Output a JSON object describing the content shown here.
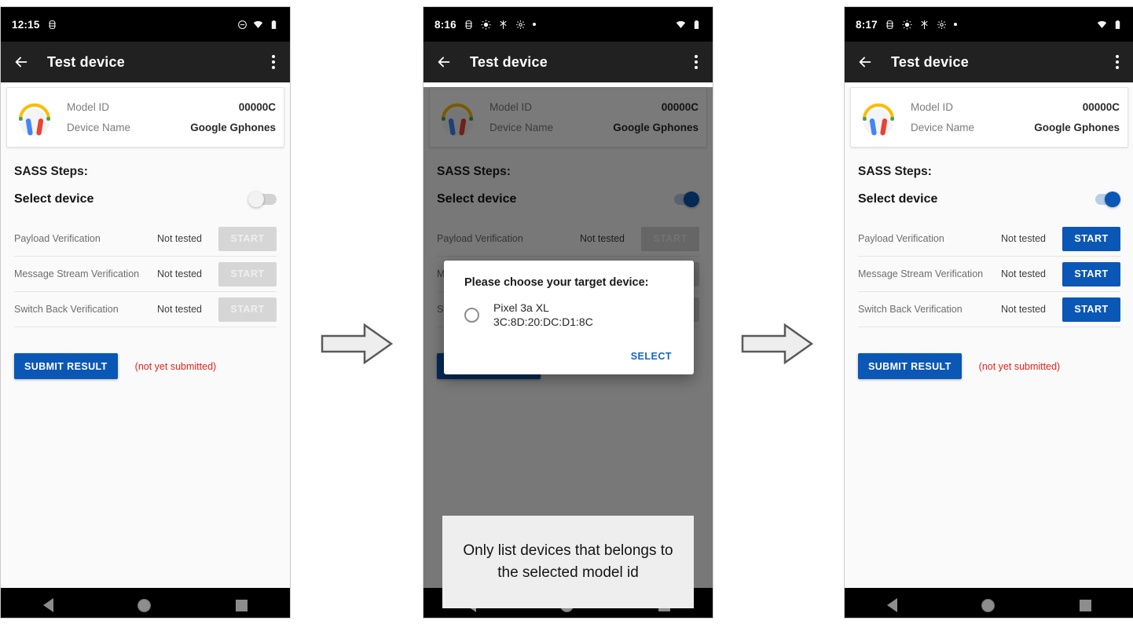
{
  "colors": {
    "accent_blue": "#0b57b5",
    "link_blue": "#1565c0",
    "error_red": "#e8231f",
    "appbar_dark": "#212121",
    "disabled_gray": "#d6d6d6"
  },
  "device": {
    "icon": "headphones-icon",
    "rows": [
      {
        "label": "Model ID",
        "value": "00000C"
      },
      {
        "label": "Device Name",
        "value": "Google Gphones"
      }
    ]
  },
  "appbar": {
    "back_icon": "back-arrow-icon",
    "title": "Test device",
    "overflow_icon": "overflow-menu-icon"
  },
  "navbar": {
    "back": "nav-back-icon",
    "home": "nav-home-icon",
    "recent": "nav-recent-icon"
  },
  "sass": {
    "heading": "SASS Steps:",
    "select_device_label": "Select device",
    "steps": [
      {
        "name": "Payload Verification",
        "status": "Not tested",
        "action": "START"
      },
      {
        "name": "Message Stream Verification",
        "status": "Not tested",
        "action": "START"
      },
      {
        "name": "Switch Back Verification",
        "status": "Not tested",
        "action": "START"
      }
    ],
    "submit_label": "SUBMIT RESULT",
    "submit_note": "(not yet submitted)"
  },
  "screens": [
    {
      "id": "screen-1",
      "status_bar": {
        "time": "12:15",
        "left_icons": [
          "android-debug-icon"
        ],
        "right_icons": [
          "do-not-disturb-icon",
          "wifi-icon",
          "battery-icon"
        ]
      },
      "toggle_state": "off"
    },
    {
      "id": "screen-2",
      "status_bar": {
        "time": "8:16",
        "left_icons": [
          "android-debug-icon",
          "brightness-icon",
          "bluetooth-search-icon",
          "settings-gear-icon",
          "dot-icon"
        ],
        "right_icons": [
          "wifi-icon",
          "battery-icon"
        ]
      },
      "toggle_state": "on"
    },
    {
      "id": "screen-3",
      "status_bar": {
        "time": "8:17",
        "left_icons": [
          "android-debug-icon",
          "brightness-icon",
          "bluetooth-search-icon",
          "settings-gear-icon",
          "dot-icon"
        ],
        "right_icons": [
          "wifi-icon",
          "battery-icon"
        ]
      },
      "toggle_state": "on"
    }
  ],
  "dialog": {
    "title": "Please choose your target device:",
    "options": [
      {
        "name": "Pixel 3a XL",
        "mac": "3C:8D:20:DC:D1:8C",
        "selected": false
      }
    ],
    "confirm_label": "SELECT"
  },
  "annotation": {
    "text": "Only list devices that belongs to the selected model id"
  },
  "flow": {
    "arrow_1": "right-arrow-icon",
    "arrow_2": "right-arrow-icon"
  }
}
